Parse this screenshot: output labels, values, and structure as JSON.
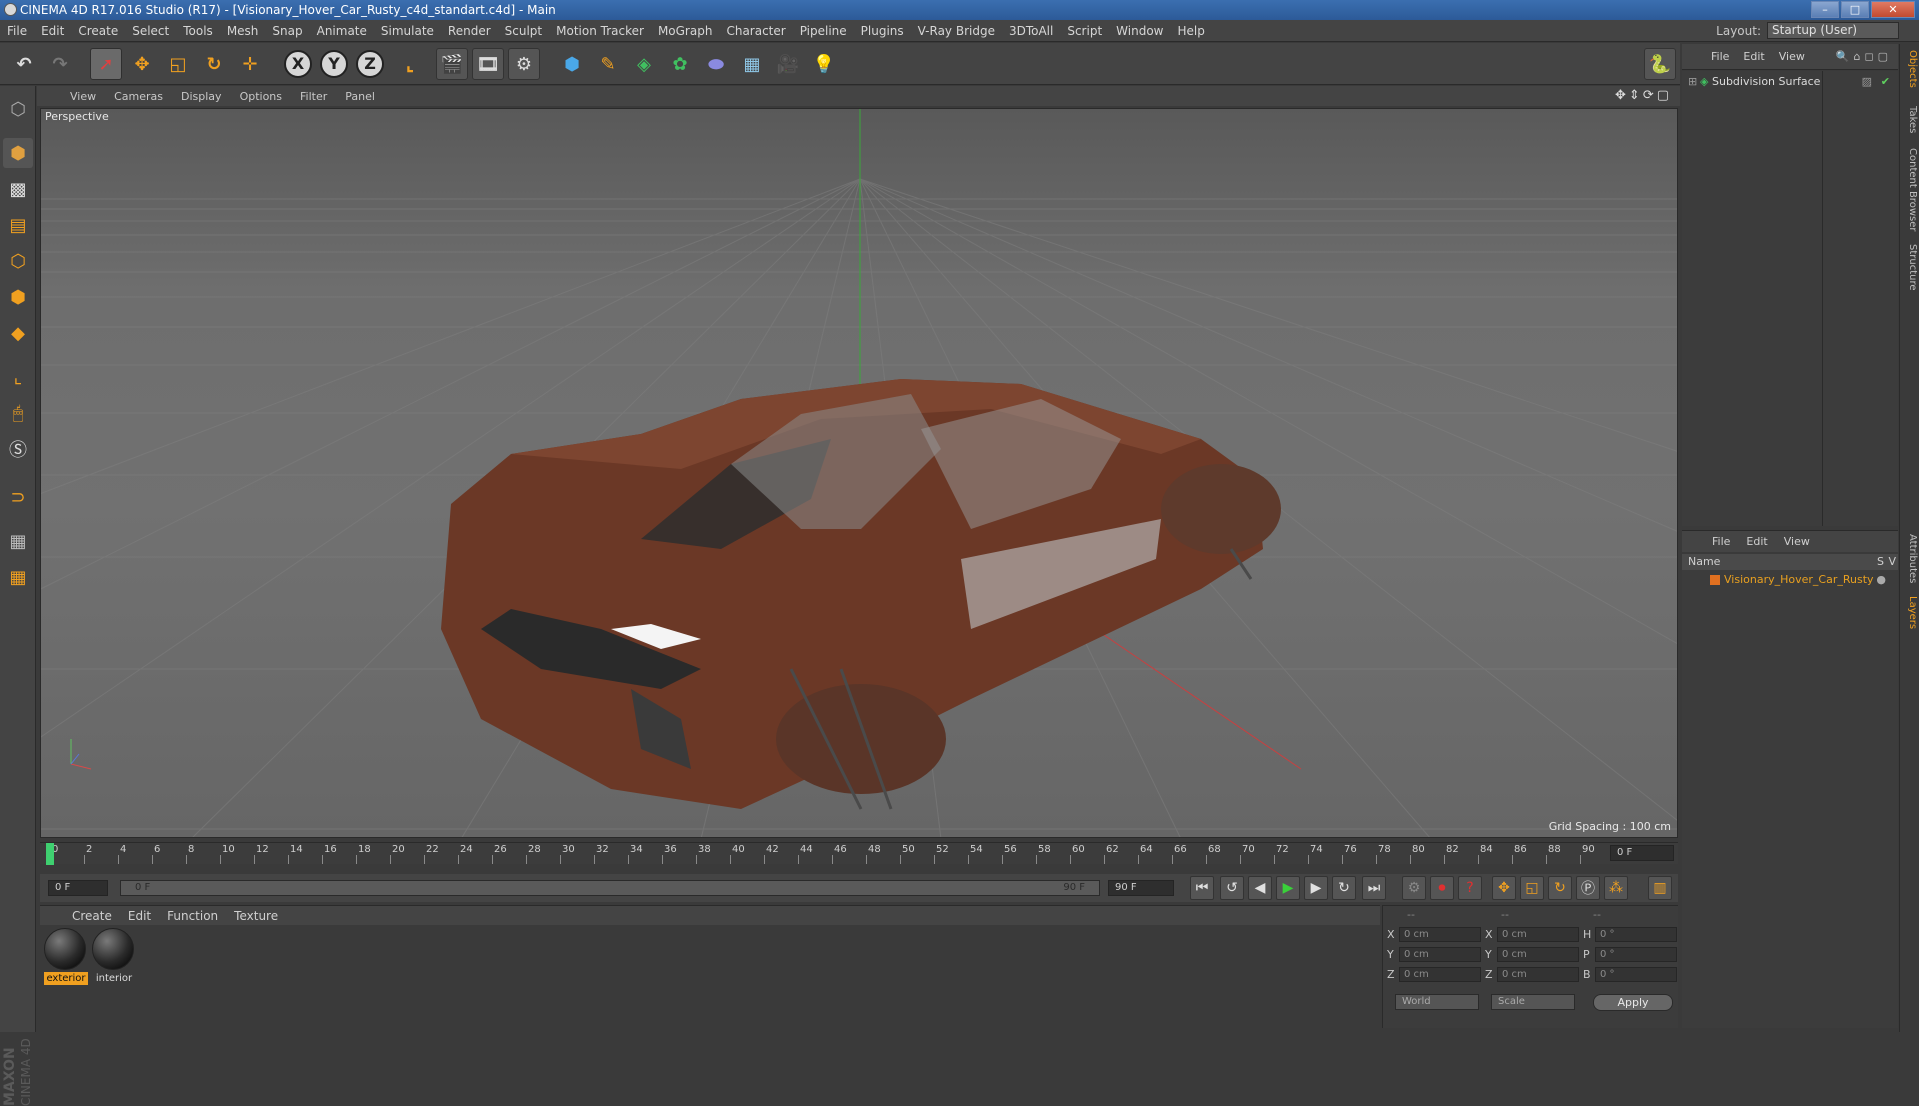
{
  "window": {
    "title": "CINEMA 4D R17.016 Studio (R17) - [Visionary_Hover_Car_Rusty_c4d_standart.c4d] - Main",
    "min": "–",
    "max": "□",
    "close": "✕"
  },
  "menu": {
    "items": [
      "File",
      "Edit",
      "Create",
      "Select",
      "Tools",
      "Mesh",
      "Snap",
      "Animate",
      "Simulate",
      "Render",
      "Sculpt",
      "Motion Tracker",
      "MoGraph",
      "Character",
      "Pipeline",
      "Plugins",
      "V-Ray Bridge",
      "3DToAll",
      "Script",
      "Window",
      "Help"
    ],
    "layout_label": "Layout:",
    "layout_value": "Startup (User)"
  },
  "viewport": {
    "menu": [
      "View",
      "Cameras",
      "Display",
      "Options",
      "Filter",
      "Panel"
    ],
    "label": "Perspective",
    "grid_spacing": "Grid Spacing : 100 cm"
  },
  "timeline": {
    "ticks": [
      "0",
      "2",
      "4",
      "6",
      "8",
      "10",
      "12",
      "14",
      "16",
      "18",
      "20",
      "22",
      "24",
      "26",
      "28",
      "30",
      "32",
      "34",
      "36",
      "38",
      "40",
      "42",
      "44",
      "46",
      "48",
      "50",
      "52",
      "54",
      "56",
      "58",
      "60",
      "62",
      "64",
      "66",
      "68",
      "70",
      "72",
      "74",
      "76",
      "78",
      "80",
      "82",
      "84",
      "86",
      "88",
      "90"
    ],
    "current_frame": "0 F",
    "start": "0 F",
    "slider_left": "0 F",
    "slider_right": "90 F",
    "end": "90 F"
  },
  "materials": {
    "menu": [
      "Create",
      "Edit",
      "Function",
      "Texture"
    ],
    "items": [
      {
        "name": "exterior",
        "selected": true
      },
      {
        "name": "interior",
        "selected": false
      }
    ]
  },
  "coords": {
    "head": [
      "--",
      "--",
      "--"
    ],
    "rows": [
      {
        "a": "X",
        "av": "0 cm",
        "b": "X",
        "bv": "0 cm",
        "c": "H",
        "cv": "0 °"
      },
      {
        "a": "Y",
        "av": "0 cm",
        "b": "Y",
        "bv": "0 cm",
        "c": "P",
        "cv": "0 °"
      },
      {
        "a": "Z",
        "av": "0 cm",
        "b": "Z",
        "bv": "0 cm",
        "c": "B",
        "cv": "0 °"
      }
    ],
    "world": "World",
    "scale": "Scale",
    "apply": "Apply"
  },
  "objects": {
    "menu": [
      "File",
      "Edit",
      "View"
    ],
    "item": "Subdivision Surface"
  },
  "layers": {
    "menu": [
      "File",
      "Edit",
      "View"
    ],
    "col_name": "Name",
    "col_s": "S",
    "col_v": "V",
    "item": "Visionary_Hover_Car_Rusty"
  },
  "tabs": [
    "Objects",
    "Takes",
    "Content Browser",
    "Structure",
    "Attributes",
    "Layers"
  ],
  "brand": {
    "maxon": "MAXON",
    "product": "CINEMA 4D"
  },
  "colors": {
    "accent": "#f0a020",
    "ui_bg": "#444444",
    "viewport": "#6e6e6e",
    "titlebar": "#2c5a98"
  }
}
